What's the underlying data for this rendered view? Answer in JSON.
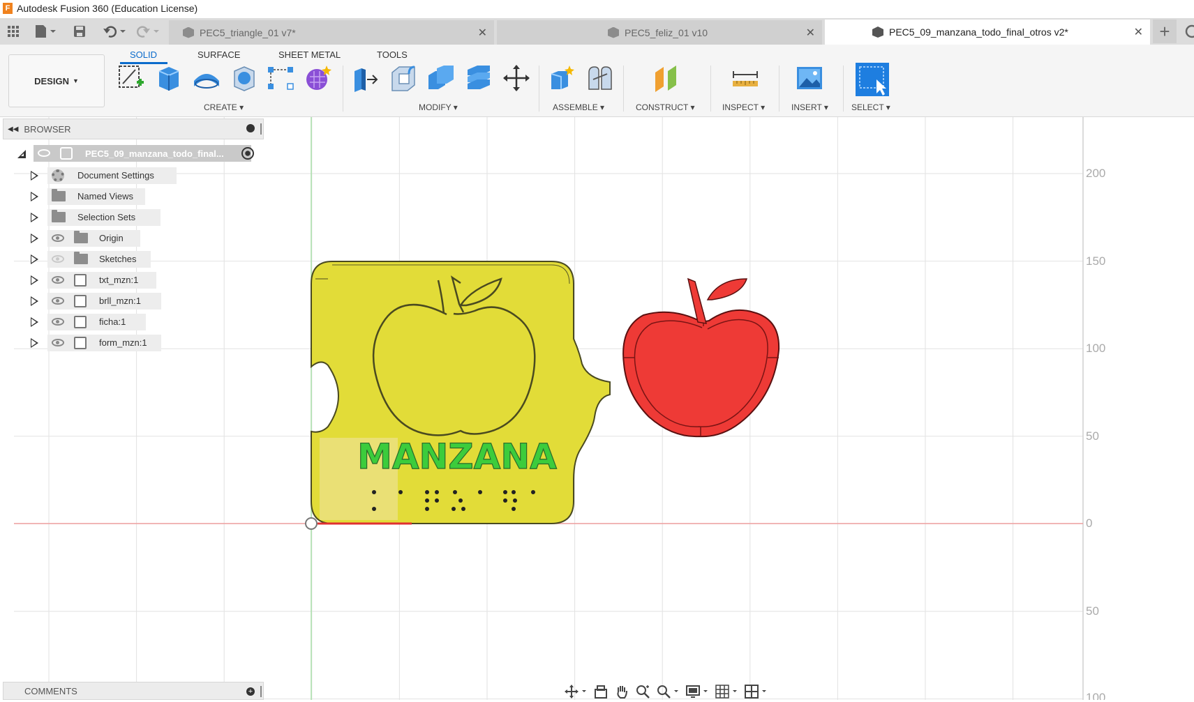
{
  "window": {
    "title": "Autodesk Fusion 360 (Education License)"
  },
  "tabs": [
    {
      "label": "PEC5_triangle_01 v7*",
      "active": false
    },
    {
      "label": "PEC5_feliz_01 v10",
      "active": false
    },
    {
      "label": "PEC5_09_manzana_todo_final_otros v2*",
      "active": true
    }
  ],
  "toolbar": {
    "workspace": "DESIGN",
    "workspace_tabs": [
      "SOLID",
      "SURFACE",
      "SHEET METAL",
      "TOOLS"
    ],
    "groups": [
      "CREATE",
      "MODIFY",
      "ASSEMBLE",
      "CONSTRUCT",
      "INSERT",
      "SELECT",
      "INSPECT"
    ]
  },
  "browser": {
    "title": "BROWSER",
    "root": "PEC5_09_manzana_todo_final...",
    "items": [
      {
        "label": "Document Settings",
        "icon": "gear-icon",
        "eye": "none"
      },
      {
        "label": "Named Views",
        "icon": "folder-icon",
        "eye": "none"
      },
      {
        "label": "Selection Sets",
        "icon": "folder-icon",
        "eye": "none"
      },
      {
        "label": "Origin",
        "icon": "folder-icon",
        "eye": "visible"
      },
      {
        "label": "Sketches",
        "icon": "folder-icon",
        "eye": "hidden"
      },
      {
        "label": "txt_mzn:1",
        "icon": "body-icon",
        "eye": "visible"
      },
      {
        "label": "brll_mzn:1",
        "icon": "body-icon",
        "eye": "visible"
      },
      {
        "label": "ficha:1",
        "icon": "body-icon",
        "eye": "visible"
      },
      {
        "label": "form_mzn:1",
        "icon": "body-icon",
        "eye": "visible"
      }
    ]
  },
  "canvas": {
    "piece_text": "MANZANA",
    "ruler_labels": [
      "200",
      "150",
      "100",
      "50",
      "0",
      "50",
      "100"
    ],
    "colors": {
      "puzzle_piece": "#e2dc38",
      "apple": "#ee3a36",
      "text": "#3ccc3c",
      "grid": "#e2e2e2",
      "x_axis": "#f0a0a0",
      "y_axis": "#a8e0a8"
    }
  },
  "comments": {
    "title": "COMMENTS"
  }
}
